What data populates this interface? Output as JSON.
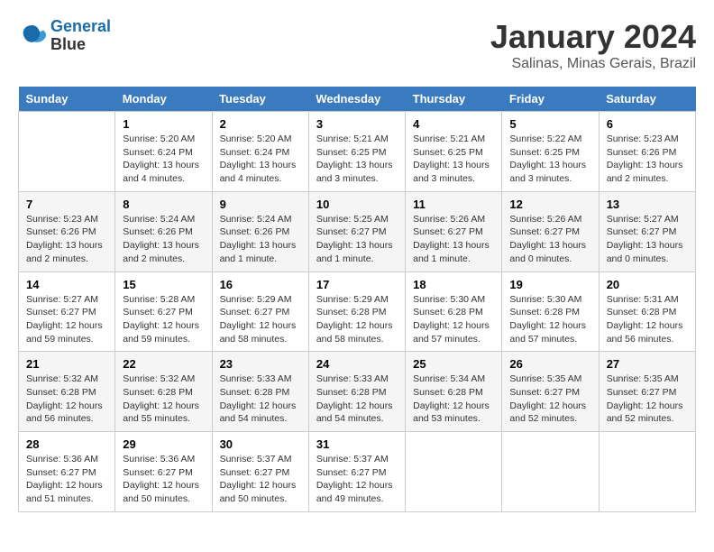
{
  "header": {
    "logo_line1": "General",
    "logo_line2": "Blue",
    "month_title": "January 2024",
    "location": "Salinas, Minas Gerais, Brazil"
  },
  "weekdays": [
    "Sunday",
    "Monday",
    "Tuesday",
    "Wednesday",
    "Thursday",
    "Friday",
    "Saturday"
  ],
  "weeks": [
    [
      {
        "day": "",
        "info": ""
      },
      {
        "day": "1",
        "info": "Sunrise: 5:20 AM\nSunset: 6:24 PM\nDaylight: 13 hours and 4 minutes."
      },
      {
        "day": "2",
        "info": "Sunrise: 5:20 AM\nSunset: 6:24 PM\nDaylight: 13 hours and 4 minutes."
      },
      {
        "day": "3",
        "info": "Sunrise: 5:21 AM\nSunset: 6:25 PM\nDaylight: 13 hours and 3 minutes."
      },
      {
        "day": "4",
        "info": "Sunrise: 5:21 AM\nSunset: 6:25 PM\nDaylight: 13 hours and 3 minutes."
      },
      {
        "day": "5",
        "info": "Sunrise: 5:22 AM\nSunset: 6:25 PM\nDaylight: 13 hours and 3 minutes."
      },
      {
        "day": "6",
        "info": "Sunrise: 5:23 AM\nSunset: 6:26 PM\nDaylight: 13 hours and 2 minutes."
      }
    ],
    [
      {
        "day": "7",
        "info": "Sunrise: 5:23 AM\nSunset: 6:26 PM\nDaylight: 13 hours and 2 minutes."
      },
      {
        "day": "8",
        "info": "Sunrise: 5:24 AM\nSunset: 6:26 PM\nDaylight: 13 hours and 2 minutes."
      },
      {
        "day": "9",
        "info": "Sunrise: 5:24 AM\nSunset: 6:26 PM\nDaylight: 13 hours and 1 minute."
      },
      {
        "day": "10",
        "info": "Sunrise: 5:25 AM\nSunset: 6:27 PM\nDaylight: 13 hours and 1 minute."
      },
      {
        "day": "11",
        "info": "Sunrise: 5:26 AM\nSunset: 6:27 PM\nDaylight: 13 hours and 1 minute."
      },
      {
        "day": "12",
        "info": "Sunrise: 5:26 AM\nSunset: 6:27 PM\nDaylight: 13 hours and 0 minutes."
      },
      {
        "day": "13",
        "info": "Sunrise: 5:27 AM\nSunset: 6:27 PM\nDaylight: 13 hours and 0 minutes."
      }
    ],
    [
      {
        "day": "14",
        "info": "Sunrise: 5:27 AM\nSunset: 6:27 PM\nDaylight: 12 hours and 59 minutes."
      },
      {
        "day": "15",
        "info": "Sunrise: 5:28 AM\nSunset: 6:27 PM\nDaylight: 12 hours and 59 minutes."
      },
      {
        "day": "16",
        "info": "Sunrise: 5:29 AM\nSunset: 6:27 PM\nDaylight: 12 hours and 58 minutes."
      },
      {
        "day": "17",
        "info": "Sunrise: 5:29 AM\nSunset: 6:28 PM\nDaylight: 12 hours and 58 minutes."
      },
      {
        "day": "18",
        "info": "Sunrise: 5:30 AM\nSunset: 6:28 PM\nDaylight: 12 hours and 57 minutes."
      },
      {
        "day": "19",
        "info": "Sunrise: 5:30 AM\nSunset: 6:28 PM\nDaylight: 12 hours and 57 minutes."
      },
      {
        "day": "20",
        "info": "Sunrise: 5:31 AM\nSunset: 6:28 PM\nDaylight: 12 hours and 56 minutes."
      }
    ],
    [
      {
        "day": "21",
        "info": "Sunrise: 5:32 AM\nSunset: 6:28 PM\nDaylight: 12 hours and 56 minutes."
      },
      {
        "day": "22",
        "info": "Sunrise: 5:32 AM\nSunset: 6:28 PM\nDaylight: 12 hours and 55 minutes."
      },
      {
        "day": "23",
        "info": "Sunrise: 5:33 AM\nSunset: 6:28 PM\nDaylight: 12 hours and 54 minutes."
      },
      {
        "day": "24",
        "info": "Sunrise: 5:33 AM\nSunset: 6:28 PM\nDaylight: 12 hours and 54 minutes."
      },
      {
        "day": "25",
        "info": "Sunrise: 5:34 AM\nSunset: 6:28 PM\nDaylight: 12 hours and 53 minutes."
      },
      {
        "day": "26",
        "info": "Sunrise: 5:35 AM\nSunset: 6:27 PM\nDaylight: 12 hours and 52 minutes."
      },
      {
        "day": "27",
        "info": "Sunrise: 5:35 AM\nSunset: 6:27 PM\nDaylight: 12 hours and 52 minutes."
      }
    ],
    [
      {
        "day": "28",
        "info": "Sunrise: 5:36 AM\nSunset: 6:27 PM\nDaylight: 12 hours and 51 minutes."
      },
      {
        "day": "29",
        "info": "Sunrise: 5:36 AM\nSunset: 6:27 PM\nDaylight: 12 hours and 50 minutes."
      },
      {
        "day": "30",
        "info": "Sunrise: 5:37 AM\nSunset: 6:27 PM\nDaylight: 12 hours and 50 minutes."
      },
      {
        "day": "31",
        "info": "Sunrise: 5:37 AM\nSunset: 6:27 PM\nDaylight: 12 hours and 49 minutes."
      },
      {
        "day": "",
        "info": ""
      },
      {
        "day": "",
        "info": ""
      },
      {
        "day": "",
        "info": ""
      }
    ]
  ]
}
